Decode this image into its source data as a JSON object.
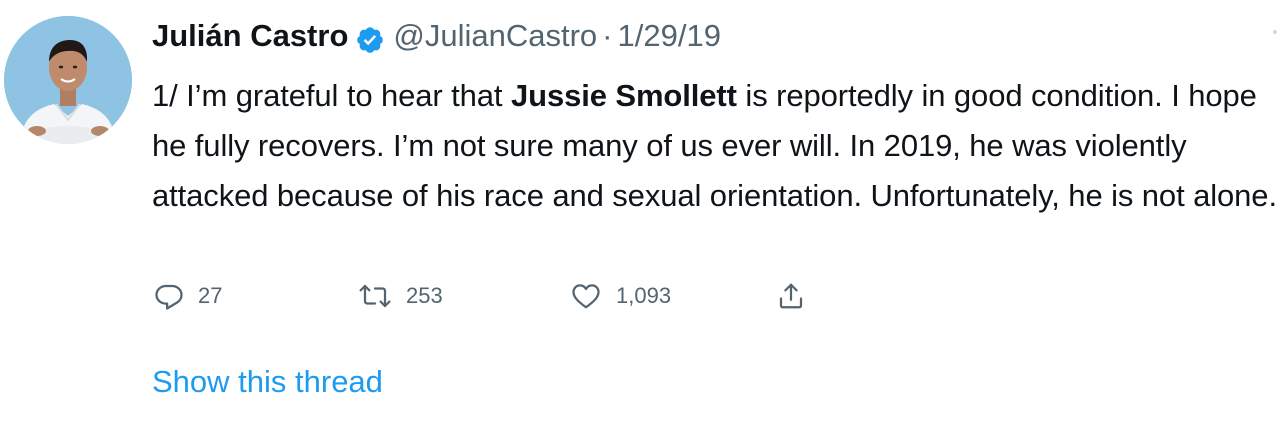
{
  "author": {
    "name": "Julián Castro",
    "handle": "@JulianCastro",
    "separator": "·",
    "date": "1/29/19",
    "verified_icon": "verified-badge-icon",
    "avatar_icon": "profile-photo"
  },
  "tweet": {
    "text_before": "1/ I’m grateful to hear that ",
    "mention": "Jussie Smollett",
    "text_after": " is reportedly in good condition. I hope he fully recovers. I’m not sure many of us ever will. In 2019, he was violently attacked because of his race and sexual orientation. Unfortunately, he is not alone."
  },
  "actions": {
    "reply": {
      "icon": "reply-icon",
      "count": "27"
    },
    "retweet": {
      "icon": "retweet-icon",
      "count": "253"
    },
    "like": {
      "icon": "heart-icon",
      "count": "1,093"
    },
    "share": {
      "icon": "share-icon"
    }
  },
  "show_thread_label": "Show this thread",
  "colors": {
    "accent": "#1d9bf0",
    "text": "#0f1419",
    "secondary": "#536471"
  }
}
